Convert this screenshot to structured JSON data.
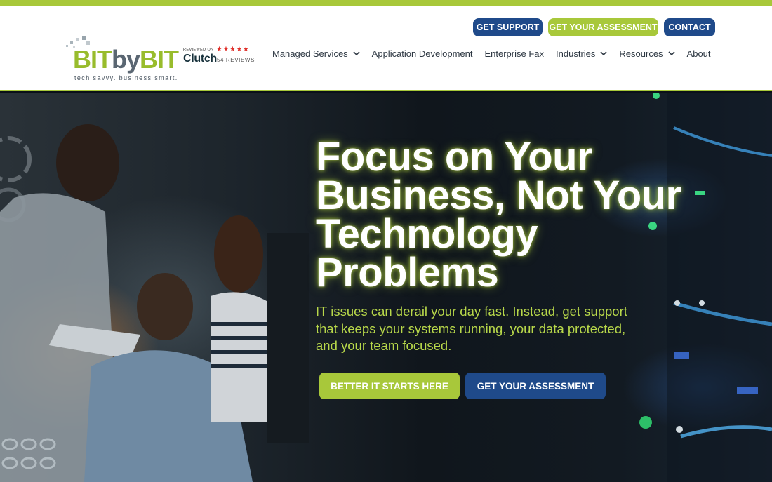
{
  "brand": {
    "logo_part1": "BIT",
    "logo_part2": "by",
    "logo_part3": "BIT",
    "tagline": "tech savvy. business smart.",
    "colors": {
      "green": "#a8c83a",
      "blue": "#1f4a8a"
    }
  },
  "clutch": {
    "reviewed_on": "REVIEWED ON",
    "stars": "★★★★★",
    "name": "Clutch",
    "reviews": "54 REVIEWS"
  },
  "top_buttons": {
    "support": "GET SUPPORT",
    "assessment": "GET YOUR ASSESSMENT",
    "contact": "CONTACT"
  },
  "nav": {
    "items": [
      {
        "label": "Managed Services",
        "has_dropdown": true
      },
      {
        "label": "Application Development",
        "has_dropdown": false
      },
      {
        "label": "Enterprise Fax",
        "has_dropdown": false
      },
      {
        "label": "Industries",
        "has_dropdown": true
      },
      {
        "label": "Resources",
        "has_dropdown": true
      },
      {
        "label": "About",
        "has_dropdown": false
      }
    ]
  },
  "hero": {
    "title_lines": [
      "Focus on Your",
      "Business, Not Your",
      "Technology",
      "Problems"
    ],
    "subtitle": "IT issues can derail your day fast. Instead, get support that keeps your systems running, your data protected, and your team focused.",
    "cta_primary": "BETTER IT STARTS HERE",
    "cta_secondary": "GET YOUR ASSESSMENT"
  }
}
